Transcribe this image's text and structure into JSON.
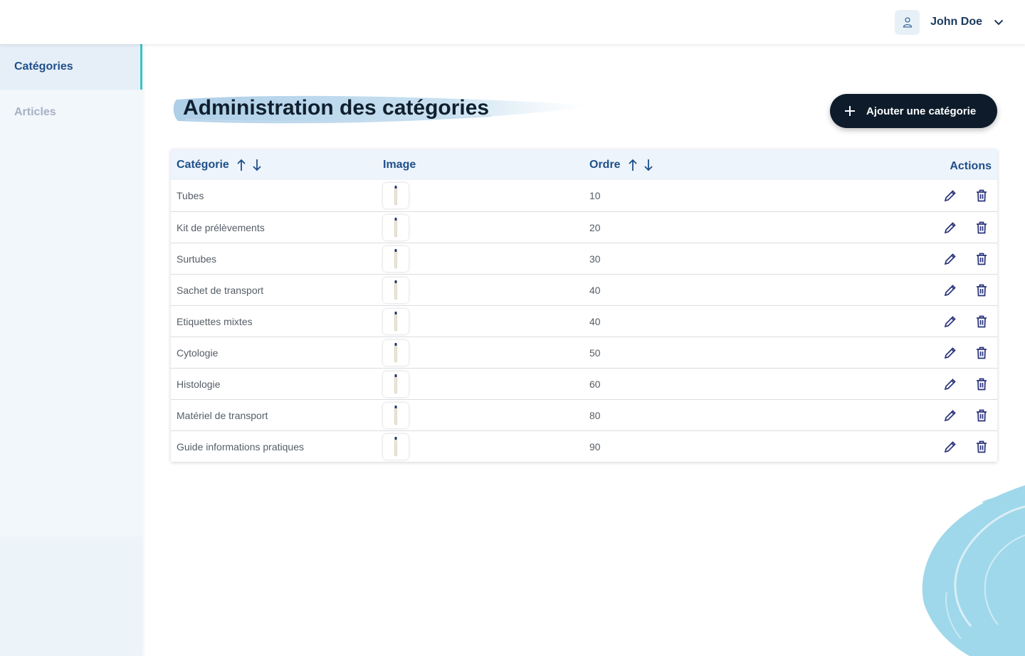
{
  "user": {
    "name": "John Doe",
    "icons": {
      "avatar": "user-icon",
      "menu": "chevron-down-icon"
    }
  },
  "sidebar": {
    "items": [
      {
        "label": "Catégories",
        "active": true
      },
      {
        "label": "Articles",
        "active": false
      }
    ]
  },
  "page": {
    "title": "Administration des catégories",
    "add_button": {
      "label": "Ajouter une catégorie",
      "icon": "plus-icon"
    }
  },
  "table": {
    "columns": {
      "category": "Catégorie",
      "image": "Image",
      "order": "Ordre",
      "actions": "Actions"
    },
    "rows": [
      {
        "category": "Tubes",
        "order": "10"
      },
      {
        "category": "Kit de prélèvements",
        "order": "20"
      },
      {
        "category": "Surtubes",
        "order": "30"
      },
      {
        "category": "Sachet de transport",
        "order": "40"
      },
      {
        "category": "Etiquettes mixtes",
        "order": "40"
      },
      {
        "category": "Cytologie",
        "order": "50"
      },
      {
        "category": "Histologie",
        "order": "60"
      },
      {
        "category": "Matériel de transport",
        "order": "80"
      },
      {
        "category": "Guide informations pratiques",
        "order": "90"
      }
    ],
    "icons": {
      "edit": "pencil-icon",
      "delete": "trash-icon",
      "sort_asc": "arrow-up-icon",
      "sort_desc": "arrow-down-icon",
      "thumbnail": "tube-icon"
    }
  },
  "colors": {
    "primary": "#1f4f8a",
    "accent": "#3cc3c9",
    "button": "#0d1b2a",
    "action_icons": "#28327a",
    "decoration": "#9fd8ea"
  }
}
